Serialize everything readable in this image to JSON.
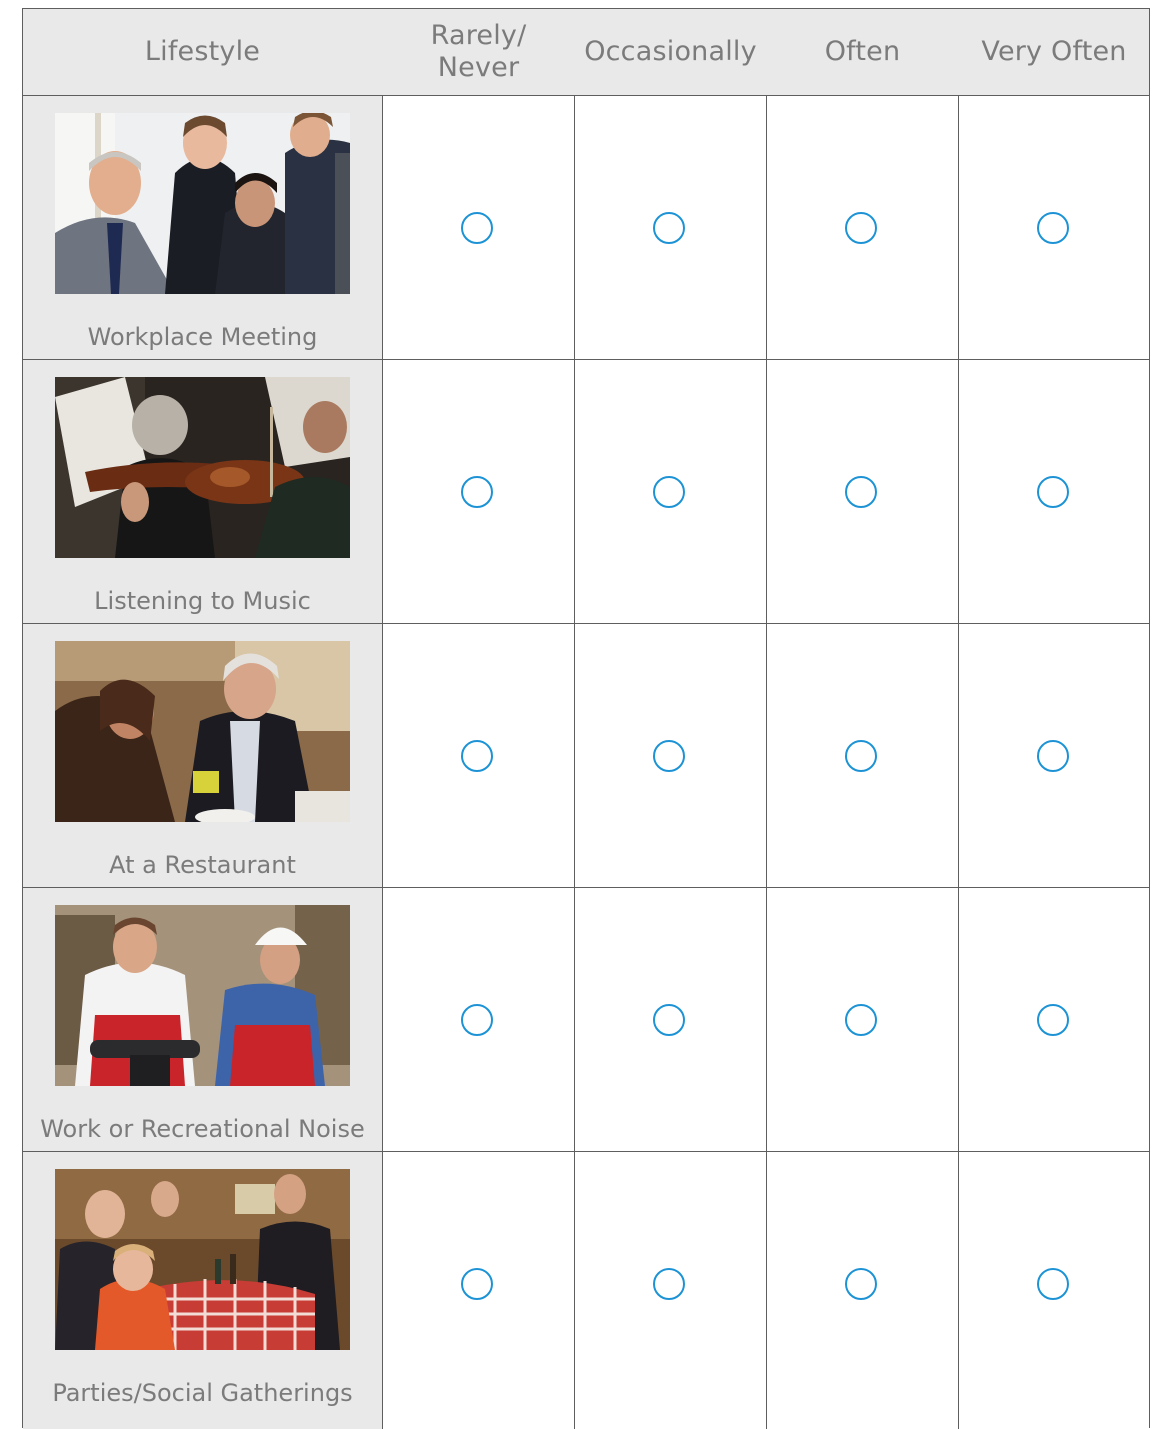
{
  "header": {
    "lifestyle": "Lifestyle",
    "options": [
      "Rarely/\nNever",
      "Occasionally",
      "Often",
      "Very Often"
    ]
  },
  "rows": [
    {
      "label": "Workplace Meeting",
      "photo_icon": "workplace-meeting-photo"
    },
    {
      "label": "Listening to Music",
      "photo_icon": "violinist-photo"
    },
    {
      "label": "At a Restaurant",
      "photo_icon": "restaurant-photo"
    },
    {
      "label": "Work or Recreational Noise",
      "photo_icon": "warehouse-workers-photo"
    },
    {
      "label": "Parties/Social Gatherings",
      "photo_icon": "family-dinner-photo"
    }
  ],
  "colors": {
    "radio_outline": "#1d93d6",
    "header_bg": "#e9e9ea",
    "grid_line": "#5e5e5e",
    "text": "#7b7b7b"
  }
}
